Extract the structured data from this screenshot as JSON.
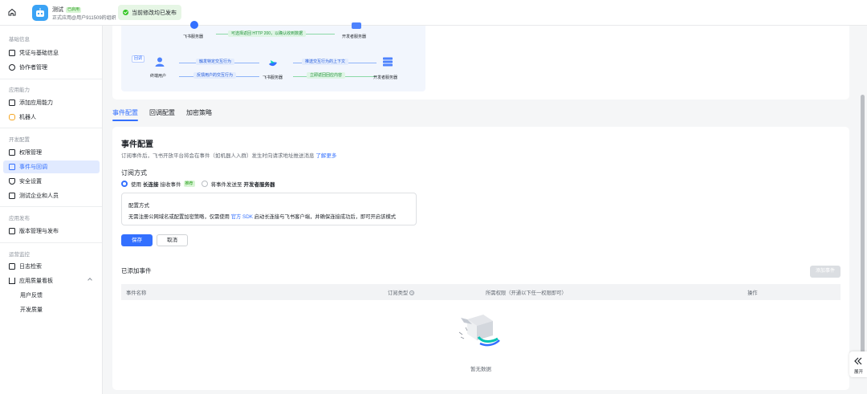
{
  "topbar": {
    "app_name": "测试",
    "status_tag": "已启用",
    "app_subtitle": "正式应用@用户911509的组织",
    "publish_notice": "当前修改均已发布"
  },
  "sidebar": {
    "groups": [
      {
        "title": "基础信息",
        "items": [
          "凭证与基础信息",
          "协作者管理"
        ]
      },
      {
        "title": "应用能力",
        "items": [
          "添加应用能力",
          "机器人"
        ]
      },
      {
        "title": "开发配置",
        "items": [
          "权限管理",
          "事件与回调",
          "安全设置",
          "测试企业和人员"
        ]
      },
      {
        "title": "应用发布",
        "items": [
          "版本管理与发布"
        ]
      },
      {
        "title": "运营监控",
        "items": [
          "日志检索",
          "应用质量看板",
          "用户反馈",
          "开发质量"
        ]
      }
    ],
    "active_item": "事件与回调"
  },
  "diagram": {
    "top_label_left": "飞书服务器",
    "top_label_right": "开发者服务器",
    "top_pill": "可选择返回 HTTP 200，以确认收到数据",
    "tag": "回调",
    "end_user": "终端用户",
    "feishu_server": "飞书服务器",
    "dev_server": "开发者服务器",
    "pill_trigger": "触发特定交互行为",
    "pill_feedback": "反馈用户的交互行为",
    "pill_push": "推送交互行为的上下文",
    "pill_return": "立即返回回应内容"
  },
  "tabs": [
    "事件配置",
    "回调配置",
    "加密策略"
  ],
  "main": {
    "title": "事件配置",
    "desc_prefix": "订阅事件后，飞书开放平台将会在事件（如机器人入群）发生时向请求地址推送消息",
    "desc_link": "了解更多",
    "subscribe_label": "订阅方式",
    "option_long_prefix": "使用",
    "option_long_bold": "长连接",
    "option_long_suffix": "接收事件",
    "option_long_tag": "推荐",
    "option_push_prefix": "将事件发送至",
    "option_push_bold": "开发者服务器",
    "cfg_title": "配置方式",
    "cfg_text_prefix": "无需注册公网域名或配置加密策略，仅需使用",
    "cfg_link": "官方 SDK",
    "cfg_text_suffix": "启动长连接与飞书客户端，并确保连接成功后，即可开启该模式",
    "save": "保存",
    "cancel": "取消",
    "added_title": "已添加事件",
    "add_button": "添加事件",
    "columns": [
      "事件名称",
      "订阅类型",
      "所需权限（开通以下任一权限即可）",
      "操作"
    ],
    "empty_text": "暂无数据"
  },
  "expand_label": "展开",
  "colors": {
    "primary": "#3370ff",
    "success": "#34c724",
    "sidebar_active_bg": "#e1eaff"
  }
}
